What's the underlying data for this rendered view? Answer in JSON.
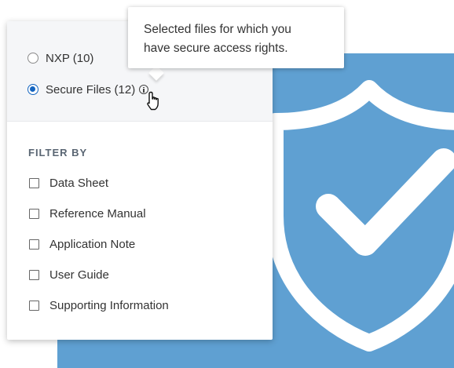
{
  "colors": {
    "accent": "#1565c0",
    "background_panel": "#5fa0d2",
    "scope_background": "#f5f6f8"
  },
  "scope": {
    "options": [
      {
        "label": "NXP (10)",
        "selected": false
      },
      {
        "label": "Secure Files (12)",
        "selected": true,
        "icon": "info-icon"
      }
    ]
  },
  "tooltip": {
    "line1": "Selected files for which you",
    "line2": "have secure access rights."
  },
  "filter": {
    "title": "FILTER BY",
    "items": [
      {
        "label": "Data Sheet",
        "checked": false
      },
      {
        "label": "Reference Manual",
        "checked": false
      },
      {
        "label": "Application Note",
        "checked": false
      },
      {
        "label": "User Guide",
        "checked": false
      },
      {
        "label": "Supporting Information",
        "checked": false
      }
    ]
  },
  "decoration": {
    "icon": "shield-check-icon"
  },
  "cursor": {
    "icon": "hand-pointer-icon"
  }
}
